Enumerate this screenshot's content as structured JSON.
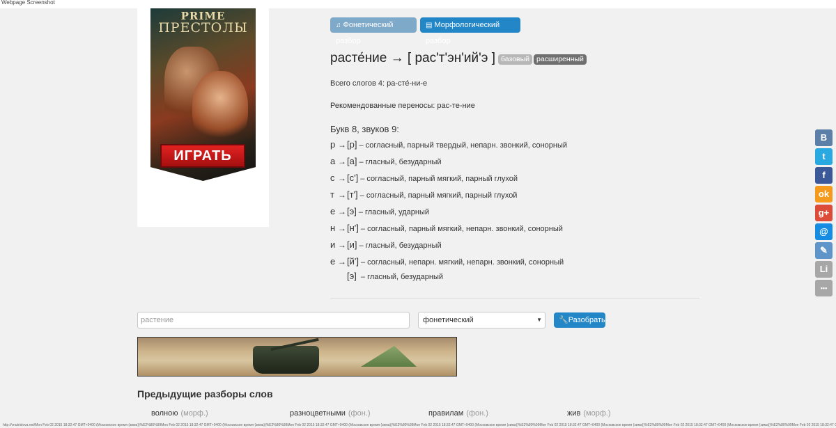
{
  "window": {
    "title": "Webpage Screenshot"
  },
  "ad": {
    "logo_top": "PRIME",
    "logo_sub": "ПРЕСТОЛЫ",
    "play_label": "ИГРАТЬ"
  },
  "toolbar": {
    "phonetic_label": "Фонетический разбор",
    "morph_label": "Морфологический разбор"
  },
  "word": {
    "title": "расте́ние → [ рас'т'эн'ий'э ]",
    "badge_basic": "базовый",
    "badge_ext": "расширенный",
    "syllables": "Всего слогов 4: ра-сте́-ни-е",
    "hyphenation": "Рекомендованные переносы: рас-те-ние",
    "letters_sounds": "Букв 8, звуков 9:"
  },
  "phonetics": [
    {
      "letter": "р",
      "sound": "[р]",
      "desc": "– согласный, парный твердый, непарн. звонкий, сонорный"
    },
    {
      "letter": "а",
      "sound": "[а]",
      "desc": "– гласный, безударный"
    },
    {
      "letter": "с",
      "sound": "[с']",
      "desc": "– согласный, парный мягкий, парный глухой"
    },
    {
      "letter": "т",
      "sound": "[т']",
      "desc": "– согласный, парный мягкий, парный глухой"
    },
    {
      "letter": "е",
      "sound": "[э]",
      "desc": "– гласный, ударный"
    },
    {
      "letter": "н",
      "sound": "[н']",
      "desc": "– согласный, парный мягкий, непарн. звонкий, сонорный"
    },
    {
      "letter": "и",
      "sound": "[и]",
      "desc": "– гласный, безударный"
    },
    {
      "letter": "е",
      "sound": "[й']",
      "desc": "– согласный, непарн. мягкий, непарн. звонкий, сонорный"
    },
    {
      "letter": "",
      "sound": "[э]",
      "desc": " – гласный, безударный"
    }
  ],
  "form": {
    "word_value": "растение",
    "type_value": "фонетический",
    "submit_label": "Разобрать"
  },
  "previous": {
    "title": "Предыдущие разборы слов",
    "items": [
      {
        "word": "волною",
        "type": "(морф.)"
      },
      {
        "word": "разноцветными",
        "type": "(фон.)"
      },
      {
        "word": "правилам",
        "type": "(фон.)"
      },
      {
        "word": "жив",
        "type": "(морф.)"
      }
    ]
  },
  "status_text": "http://vnutrislova.net/Mon Feb 02 2015 18:32:47 GMT+0400 (Московское время (зима))%E2%80%99Mon Feb 02 2015 18:32:47 GMT+0400 (Московское время (зима))%E2%80%99Mon Feb 02 2015 18:32:47 GMT+0400 (Московское время (зима))%E2%80%99Mon Feb 02 2015 18:32:47 GMT+0400 (Московское время (зима))%E2%80%99Mon Feb 02 2015 18:32:47 GMT+0400 (Московское время (зима))%E2%80%99Mon Feb 02 2015 18:32:47 GMT+0400 (Московское время (зима))%E2%80%99Mon Feb 02 2015 18:32:47 GMT+0400",
  "social": [
    {
      "name": "vkontakte-icon",
      "glyph": "B",
      "color": "#5b7fa6"
    },
    {
      "name": "twitter-icon",
      "glyph": "t",
      "color": "#29a9e1"
    },
    {
      "name": "facebook-icon",
      "glyph": "f",
      "color": "#3b5998"
    },
    {
      "name": "odnoklassniki-icon",
      "glyph": "ok",
      "color": "#f59a1b"
    },
    {
      "name": "google-plus-icon",
      "glyph": "g+",
      "color": "#dd4b39"
    },
    {
      "name": "mailru-icon",
      "glyph": "@",
      "color": "#168de2"
    },
    {
      "name": "livejournal-icon",
      "glyph": "✎",
      "color": "#5f95c8"
    },
    {
      "name": "liveinternet-icon",
      "glyph": "Li",
      "color": "#a7a7a7"
    },
    {
      "name": "more-icon",
      "glyph": "•••",
      "color": "#a7a7a7"
    }
  ]
}
